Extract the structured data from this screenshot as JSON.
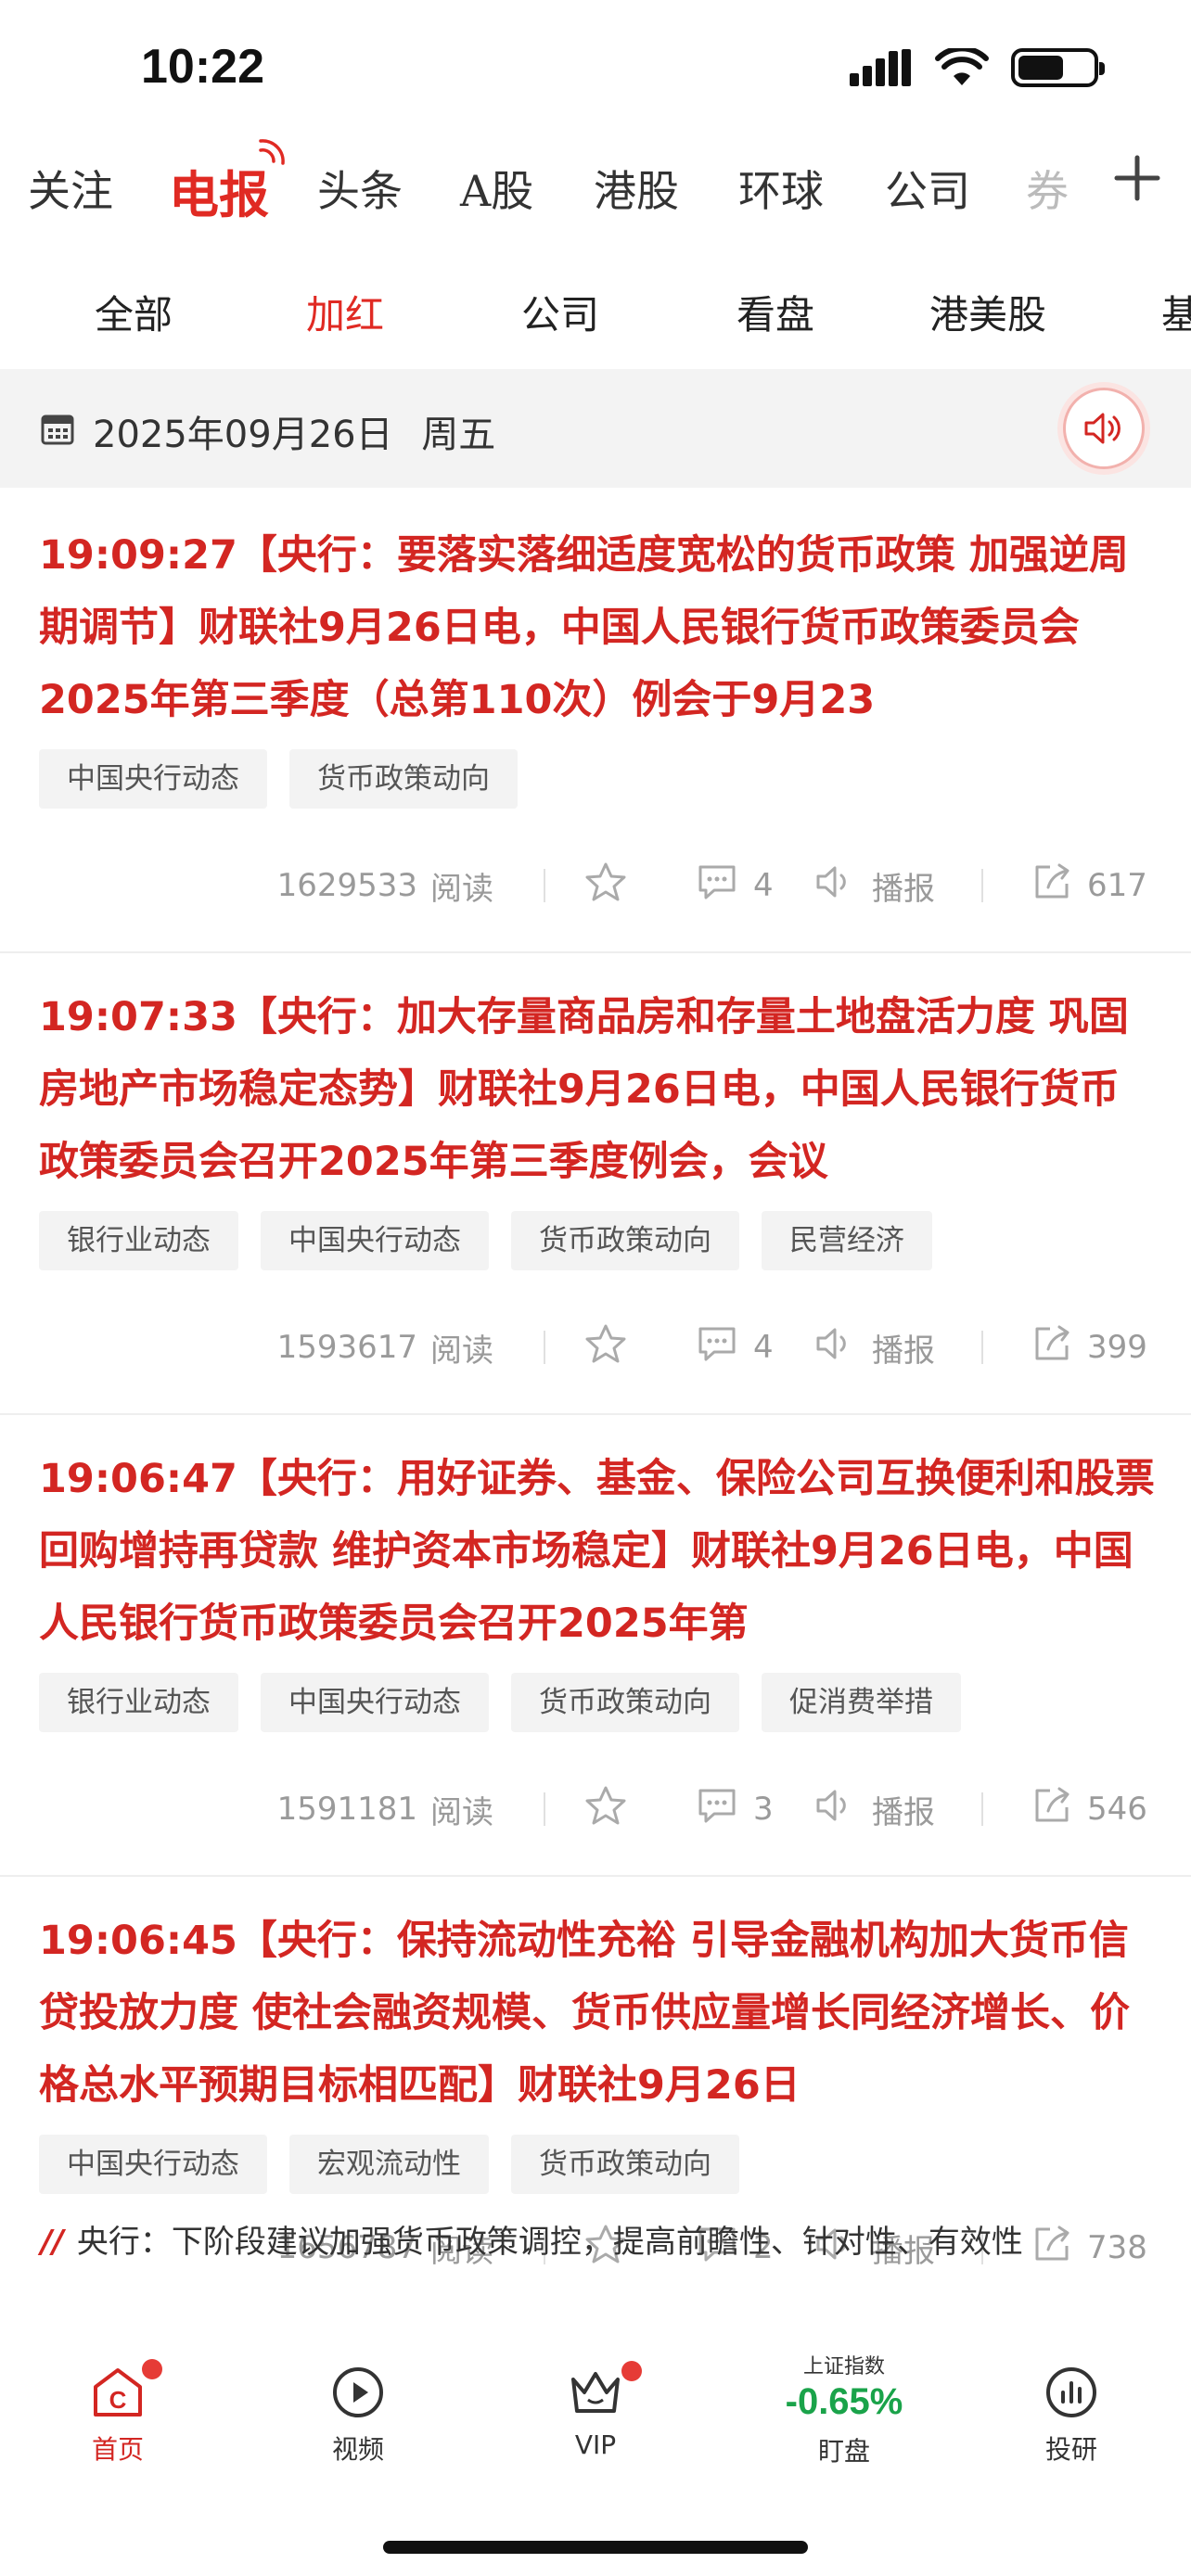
{
  "status_bar": {
    "time": "10:22"
  },
  "top_nav": {
    "tabs": [
      "关注",
      "电报",
      "头条",
      "A股",
      "港股",
      "环球",
      "公司",
      "券"
    ],
    "active": "电报"
  },
  "sub_nav": {
    "tabs": [
      "全部",
      "加红",
      "公司",
      "看盘",
      "港美股",
      "基"
    ],
    "active": "加红"
  },
  "date_bar": {
    "date": "2025年09月26日",
    "weekday": "周五"
  },
  "news": [
    {
      "title": "19:09:27【央行：要落实落细适度宽松的货币政策 加强逆周期调节】财联社9月26日电，中国人民银行货币政策委员会2025年第三季度（总第110次）例会于9月23",
      "tags": [
        "中国央行动态",
        "货币政策动向"
      ],
      "reads": "1629533",
      "reads_label": "阅读",
      "comments": "4",
      "play_label": "播报",
      "shares": "617"
    },
    {
      "title": "19:07:33【央行：加大存量商品房和存量土地盘活力度 巩固房地产市场稳定态势】财联社9月26日电，中国人民银行货币政策委员会召开2025年第三季度例会，会议",
      "tags": [
        "银行业动态",
        "中国央行动态",
        "货币政策动向",
        "民营经济"
      ],
      "reads": "1593617",
      "reads_label": "阅读",
      "comments": "4",
      "play_label": "播报",
      "shares": "399"
    },
    {
      "title": "19:06:47【央行：用好证券、基金、保险公司互换便利和股票回购增持再贷款 维护资本市场稳定】财联社9月26日电，中国人民银行货币政策委员会召开2025年第",
      "tags": [
        "银行业动态",
        "中国央行动态",
        "货币政策动向",
        "促消费举措"
      ],
      "reads": "1591181",
      "reads_label": "阅读",
      "comments": "3",
      "play_label": "播报",
      "shares": "546"
    },
    {
      "title": "19:06:45【央行：保持流动性充裕 引导金融机构加大货币信贷投放力度 使社会融资规模、货币供应量增长同经济增长、价格总水平预期目标相匹配】财联社9月26日",
      "tags": [
        "中国央行动态",
        "宏观流动性",
        "货币政策动向"
      ],
      "reads": "1656787",
      "reads_label": "阅读",
      "comments": "2",
      "play_label": "播报",
      "shares": "738"
    }
  ],
  "quote": {
    "mark": "//",
    "text": "央行：下阶段建议加强货币政策调控，提高前瞻性、针对性、有效性"
  },
  "tab_bar": {
    "home": "首页",
    "video": "视频",
    "vip": "VIP",
    "watch": "盯盘",
    "research": "投研",
    "index_name": "上证指数",
    "index_value": "-0.65%"
  },
  "colors": {
    "accent": "#d32622",
    "index_down": "#1aa34a"
  }
}
